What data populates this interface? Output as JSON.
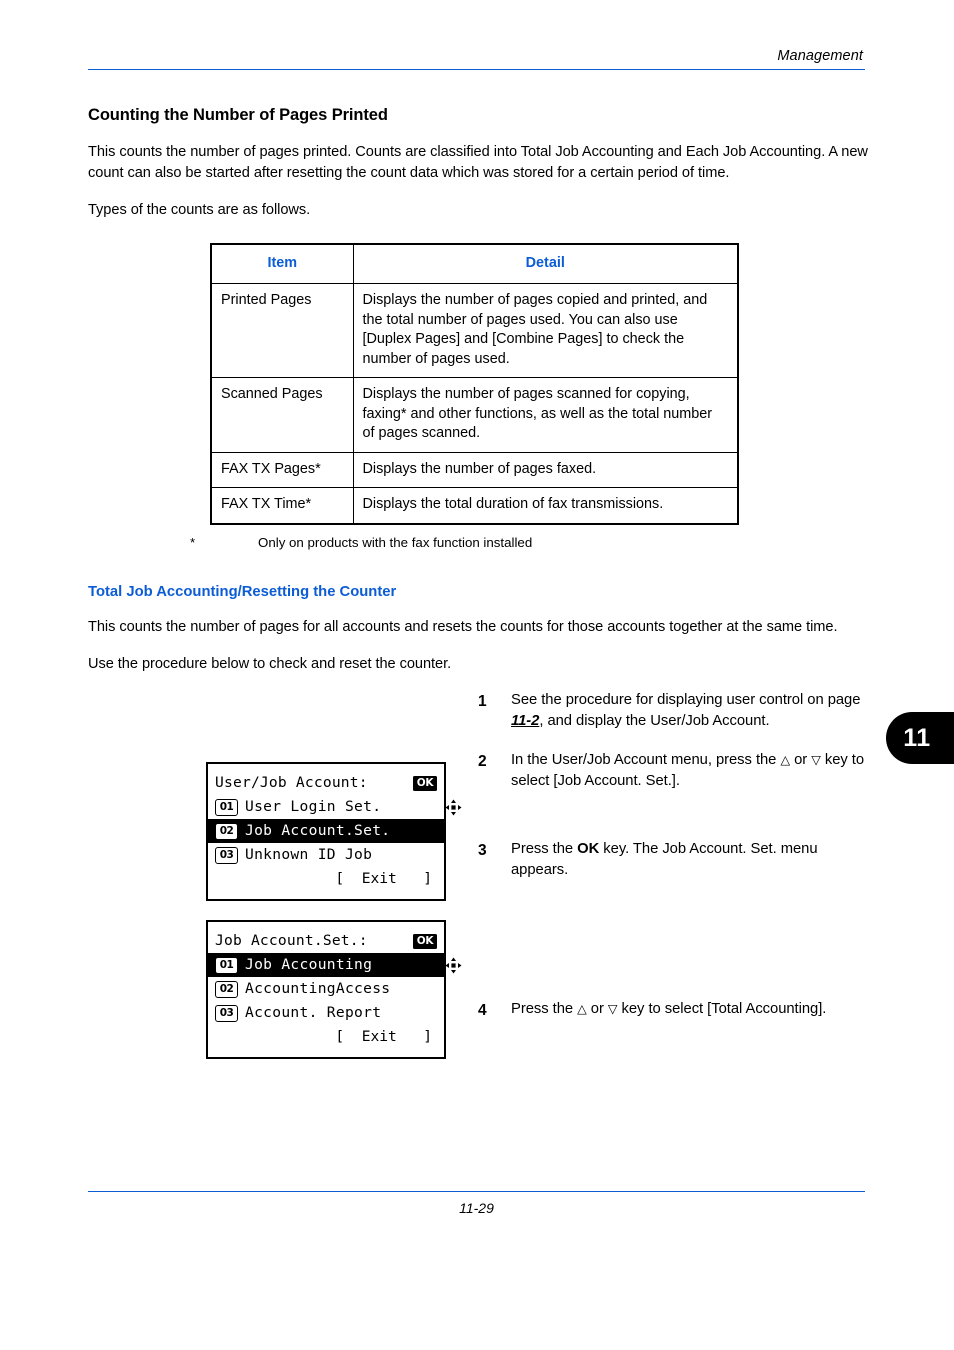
{
  "header": {
    "title": "Management"
  },
  "section": {
    "title": "Counting the Number of Pages Printed",
    "intro_paragraph": "This counts the number of pages printed. Counts are classified into Total Job Accounting and Each Job Accounting. A new count can also be started after resetting the count data which was stored for a certain period of time.",
    "types_lead": "Types of the counts are as follows."
  },
  "table": {
    "headers": [
      "Item",
      "Detail"
    ],
    "rows": [
      {
        "item": "Printed Pages",
        "detail": "Displays the number of pages copied and printed, and the total number of pages used. You can also use [Duplex Pages] and [Combine Pages] to check the number of pages used."
      },
      {
        "item": "Scanned Pages",
        "detail": "Displays the number of pages scanned for copying, faxing* and other functions, as well as the total number of pages scanned."
      },
      {
        "item": "FAX TX Pages*",
        "detail": "Displays the number of pages faxed."
      },
      {
        "item": "FAX TX Time*",
        "detail": "Displays the total duration of fax transmissions."
      }
    ],
    "footnote_mark": "*",
    "footnote_text": "Only on products with the fax function installed"
  },
  "subsection": {
    "title": "Total Job Accounting/Resetting the Counter",
    "paragraph_1": "This counts the number of pages for all accounts and resets the counts for those accounts together at the same time.",
    "paragraph_2": "Use the procedure below to check and reset the counter."
  },
  "steps": [
    {
      "number": "1",
      "text_before": "See the procedure for displaying user control on page ",
      "xref": "11-2",
      "text_after": ", and display the User/Job Account."
    },
    {
      "number": "2",
      "text_before": "In the User/Job Account menu, press the ",
      "arrow_up": "△",
      "text_mid": " or ",
      "arrow_down": "▽",
      "text_after": " key to select [Job Account. Set.]."
    },
    {
      "number": "3",
      "text_before": "Press the ",
      "bold": "OK",
      "text_after": " key. The Job Account. Set. menu appears."
    },
    {
      "number": "4",
      "text_before": "Press the ",
      "arrow_up": "△",
      "text_mid": " or ",
      "arrow_down": "▽",
      "text_after": " key to select [Total Accounting]."
    }
  ],
  "lcd_panels": [
    {
      "title": "User/Job Account:",
      "ok_label": "OK",
      "items": [
        {
          "num": "01",
          "label": "User Login Set.",
          "selected": false
        },
        {
          "num": "02",
          "label": "Job Account.Set.",
          "selected": true
        },
        {
          "num": "03",
          "label": "Unknown ID Job",
          "selected": false
        }
      ],
      "exit": "[  Exit   ]"
    },
    {
      "title": "Job Account.Set.:",
      "ok_label": "OK",
      "items": [
        {
          "num": "01",
          "label": "Job Accounting",
          "selected": true
        },
        {
          "num": "02",
          "label": "AccountingAccess",
          "selected": false
        },
        {
          "num": "03",
          "label": "Account. Report",
          "selected": false
        }
      ],
      "exit": "[  Exit   ]"
    }
  ],
  "chapter_tab": "11",
  "footer": {
    "page_number": "11-29"
  },
  "colors": {
    "accent_blue": "#0B5CD5",
    "text_black": "#000000",
    "page_background": "#FFFFFF"
  }
}
